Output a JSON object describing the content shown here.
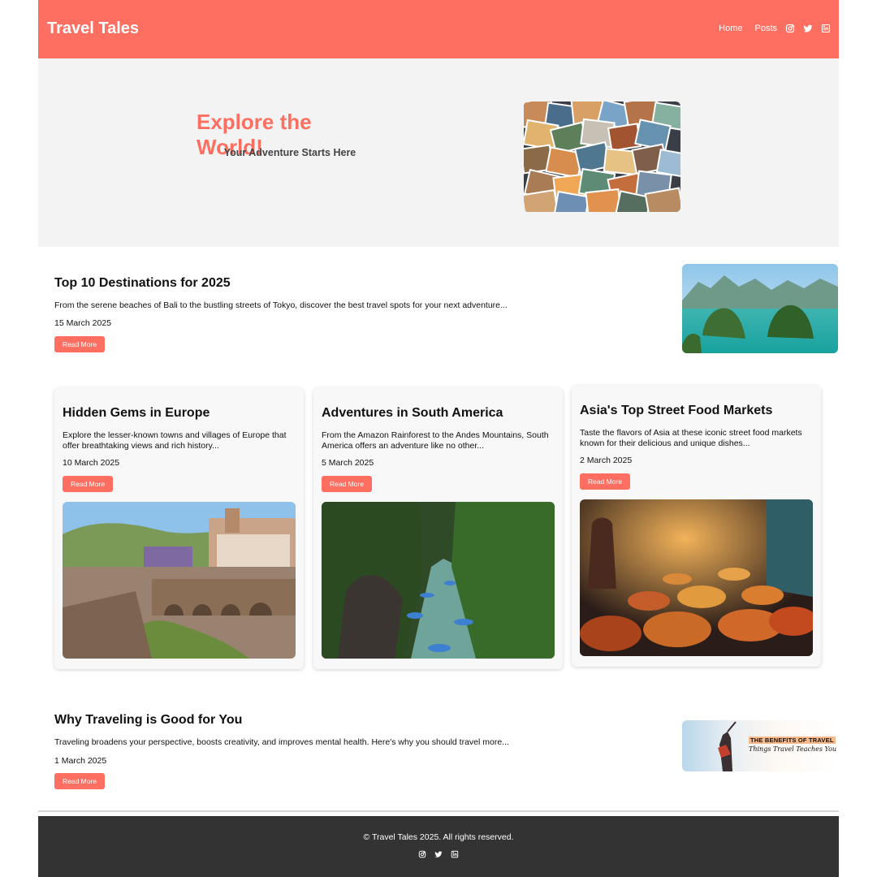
{
  "header": {
    "brand": "Travel Tales",
    "nav": [
      {
        "label": "Home"
      },
      {
        "label": "Posts"
      }
    ],
    "social_icons": [
      "instagram-icon",
      "twitter-icon",
      "linkedin-icon"
    ]
  },
  "hero": {
    "title": "Explore the World!",
    "subtitle": "Your Adventure Starts Here"
  },
  "featured_top": {
    "title": "Top 10 Destinations for 2025",
    "excerpt": "From the serene beaches of Bali to the bustling streets of Tokyo, discover the best travel spots for your next adventure...",
    "date": "15 March 2025",
    "button": "Read More"
  },
  "cards": [
    {
      "title": "Hidden Gems in Europe",
      "excerpt": "Explore the lesser-known towns and villages of Europe that offer breathtaking views and rich history...",
      "date": "10 March 2025",
      "button": "Read More"
    },
    {
      "title": "Adventures in South America",
      "excerpt": "From the Amazon Rainforest to the Andes Mountains, South America offers an adventure like no other...",
      "date": "5 March 2025",
      "button": "Read More"
    },
    {
      "title": "Asia's Top Street Food Markets",
      "excerpt": "Taste the flavors of Asia at these iconic street food markets known for their delicious and unique dishes...",
      "date": "2 March 2025",
      "button": "Read More"
    }
  ],
  "featured_bottom": {
    "title": "Why Traveling is Good for You",
    "excerpt": "Traveling broadens your perspective, boosts creativity, and improves mental health. Here's why you should travel more...",
    "date": "1 March 2025",
    "button": "Read More",
    "image_text_1": "THE BENEFITS OF TRAVEL",
    "image_text_2": "Things Travel Teaches You"
  },
  "footer": {
    "copyright": "© Travel Tales 2025. All rights reserved.",
    "social_icons": [
      "instagram-icon",
      "twitter-icon",
      "linkedin-icon"
    ]
  },
  "colors": {
    "accent": "#ff6f61",
    "hero_bg": "#f3f3f3",
    "footer_bg": "#333333"
  }
}
